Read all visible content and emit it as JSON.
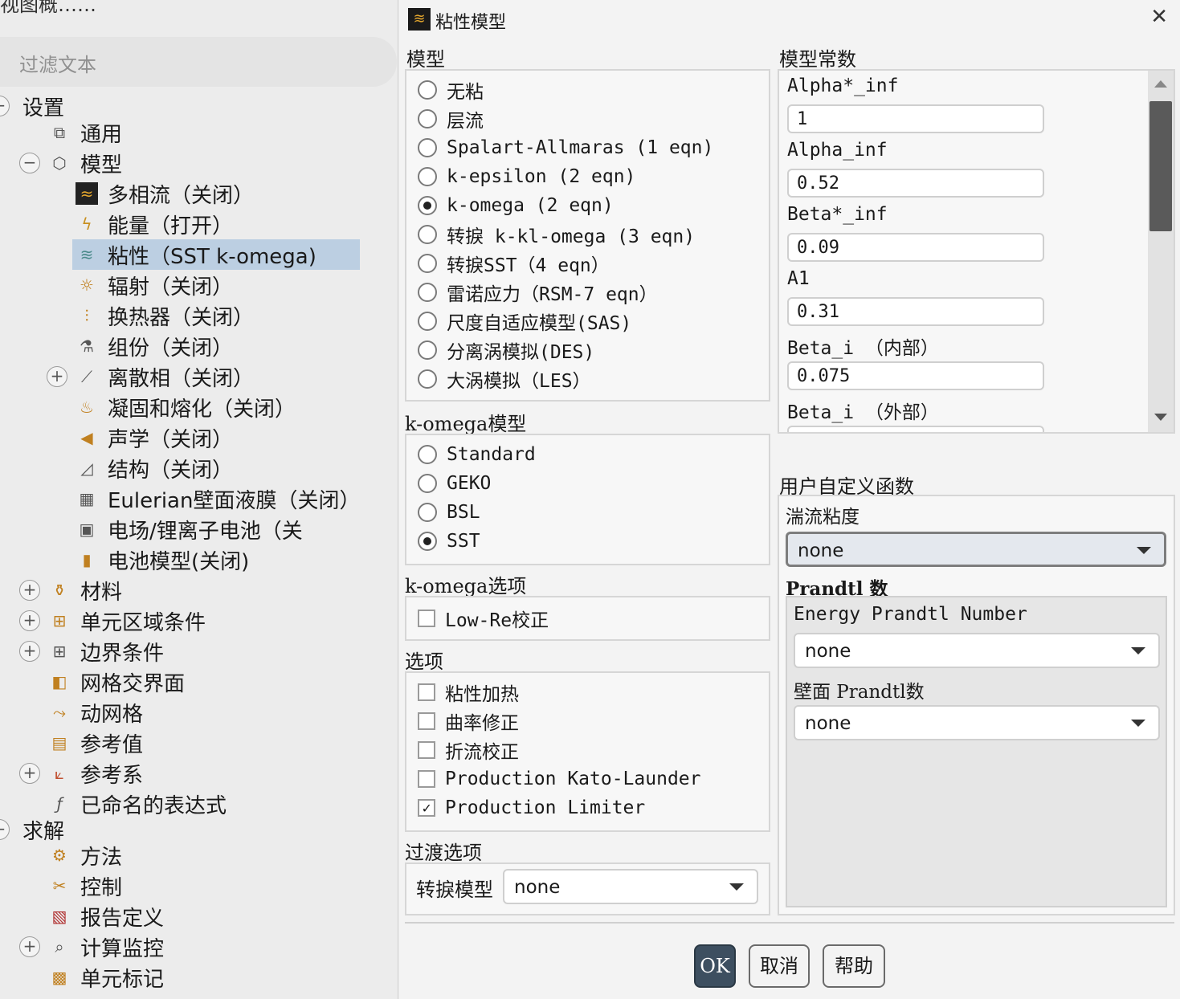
{
  "left_panel": {
    "top_clip": "视图概……",
    "filter_placeholder": "过滤文本",
    "tree": [
      {
        "label": "设置",
        "icon": "setup-icon"
      },
      {
        "label": "通用",
        "icon": "general-icon"
      },
      {
        "label": "模型",
        "icon": "models-icon"
      },
      {
        "label": "多相流（关闭）",
        "icon": "multiphase-icon"
      },
      {
        "label": "能量（打开）",
        "icon": "energy-icon"
      },
      {
        "label": "粘性（SST k-omega)",
        "icon": "viscous-icon"
      },
      {
        "label": "辐射（关闭）",
        "icon": "radiation-icon"
      },
      {
        "label": "换热器（关闭）",
        "icon": "heat-exchanger-icon"
      },
      {
        "label": "组份（关闭）",
        "icon": "species-icon"
      },
      {
        "label": "离散相（关闭）",
        "icon": "discrete-phase-icon"
      },
      {
        "label": "凝固和熔化（关闭）",
        "icon": "solidification-icon"
      },
      {
        "label": "声学（关闭）",
        "icon": "acoustics-icon"
      },
      {
        "label": "结构（关闭）",
        "icon": "structure-icon"
      },
      {
        "label": "Eulerian壁面液膜（关闭）",
        "icon": "wall-film-icon"
      },
      {
        "label": "电场/锂离子电池（关",
        "icon": "electric-field-icon"
      },
      {
        "label": "电池模型(关闭)",
        "icon": "battery-icon"
      },
      {
        "label": "材料",
        "icon": "materials-icon"
      },
      {
        "label": "单元区域条件",
        "icon": "cell-zone-icon"
      },
      {
        "label": "边界条件",
        "icon": "boundary-icon"
      },
      {
        "label": "网格交界面",
        "icon": "mesh-interface-icon"
      },
      {
        "label": "动网格",
        "icon": "dynamic-mesh-icon"
      },
      {
        "label": "参考值",
        "icon": "reference-values-icon"
      },
      {
        "label": "参考系",
        "icon": "reference-frame-icon"
      },
      {
        "label": "已命名的表达式",
        "icon": "expressions-icon"
      },
      {
        "label": "求解",
        "icon": "solution-icon"
      },
      {
        "label": "方法",
        "icon": "methods-icon"
      },
      {
        "label": "控制",
        "icon": "controls-icon"
      },
      {
        "label": "报告定义",
        "icon": "report-definitions-icon"
      },
      {
        "label": "计算监控",
        "icon": "monitors-icon"
      },
      {
        "label": "单元标记",
        "icon": "cell-registers-icon"
      }
    ]
  },
  "dialog": {
    "title": "粘性模型",
    "model_section": {
      "label": "模型",
      "options": [
        "无粘",
        "层流",
        "Spalart-Allmaras (1 eqn)",
        "k-epsilon (2 eqn)",
        "k-omega (2 eqn)",
        "转捩 k-kl-omega (3 eqn)",
        "转捩SST（4 eqn）",
        "雷诺应力（RSM-7 eqn）",
        "尺度自适应模型(SAS)",
        "分离涡模拟(DES)",
        "大涡模拟（LES）"
      ],
      "selected": 4
    },
    "komega_model": {
      "label": "k-omega模型",
      "options": [
        "Standard",
        "GEKO",
        "BSL",
        "SST"
      ],
      "selected": 3
    },
    "komega_options": {
      "label": "k-omega选项",
      "items": [
        {
          "label": "Low-Re校正",
          "checked": false
        }
      ]
    },
    "options": {
      "label": "选项",
      "items": [
        {
          "label": "粘性加热",
          "checked": false
        },
        {
          "label": "曲率修正",
          "checked": false
        },
        {
          "label": "折流校正",
          "checked": false
        },
        {
          "label": "Production Kato-Launder",
          "checked": false
        },
        {
          "label": "Production Limiter",
          "checked": true
        }
      ]
    },
    "transition": {
      "label": "过渡选项",
      "field_label": "转捩模型",
      "value": "none"
    },
    "constants": {
      "label": "模型常数",
      "items": [
        {
          "name": "Alpha*_inf",
          "value": "1"
        },
        {
          "name": "Alpha_inf",
          "value": "0.52"
        },
        {
          "name": "Beta*_inf",
          "value": "0.09"
        },
        {
          "name": "A1",
          "value": "0.31"
        },
        {
          "name": "Beta_i （内部）",
          "value": "0.075"
        },
        {
          "name": "Beta_i （外部）",
          "value": ""
        }
      ]
    },
    "udf": {
      "label": "用户自定义函数",
      "turb_visc_label": "湍流粘度",
      "turb_visc_value": "none",
      "prandtl_label": "Prandtl 数",
      "energy_prandtl_label": "Energy Prandtl Number",
      "energy_prandtl_value": "none",
      "wall_prandtl_label": "壁面 Prandtl数",
      "wall_prandtl_value": "none"
    },
    "buttons": {
      "ok": "OK",
      "cancel": "取消",
      "help": "帮助"
    }
  },
  "colors": {
    "selected_row": "#bccfe2",
    "ok_button": "#3d4f60"
  }
}
